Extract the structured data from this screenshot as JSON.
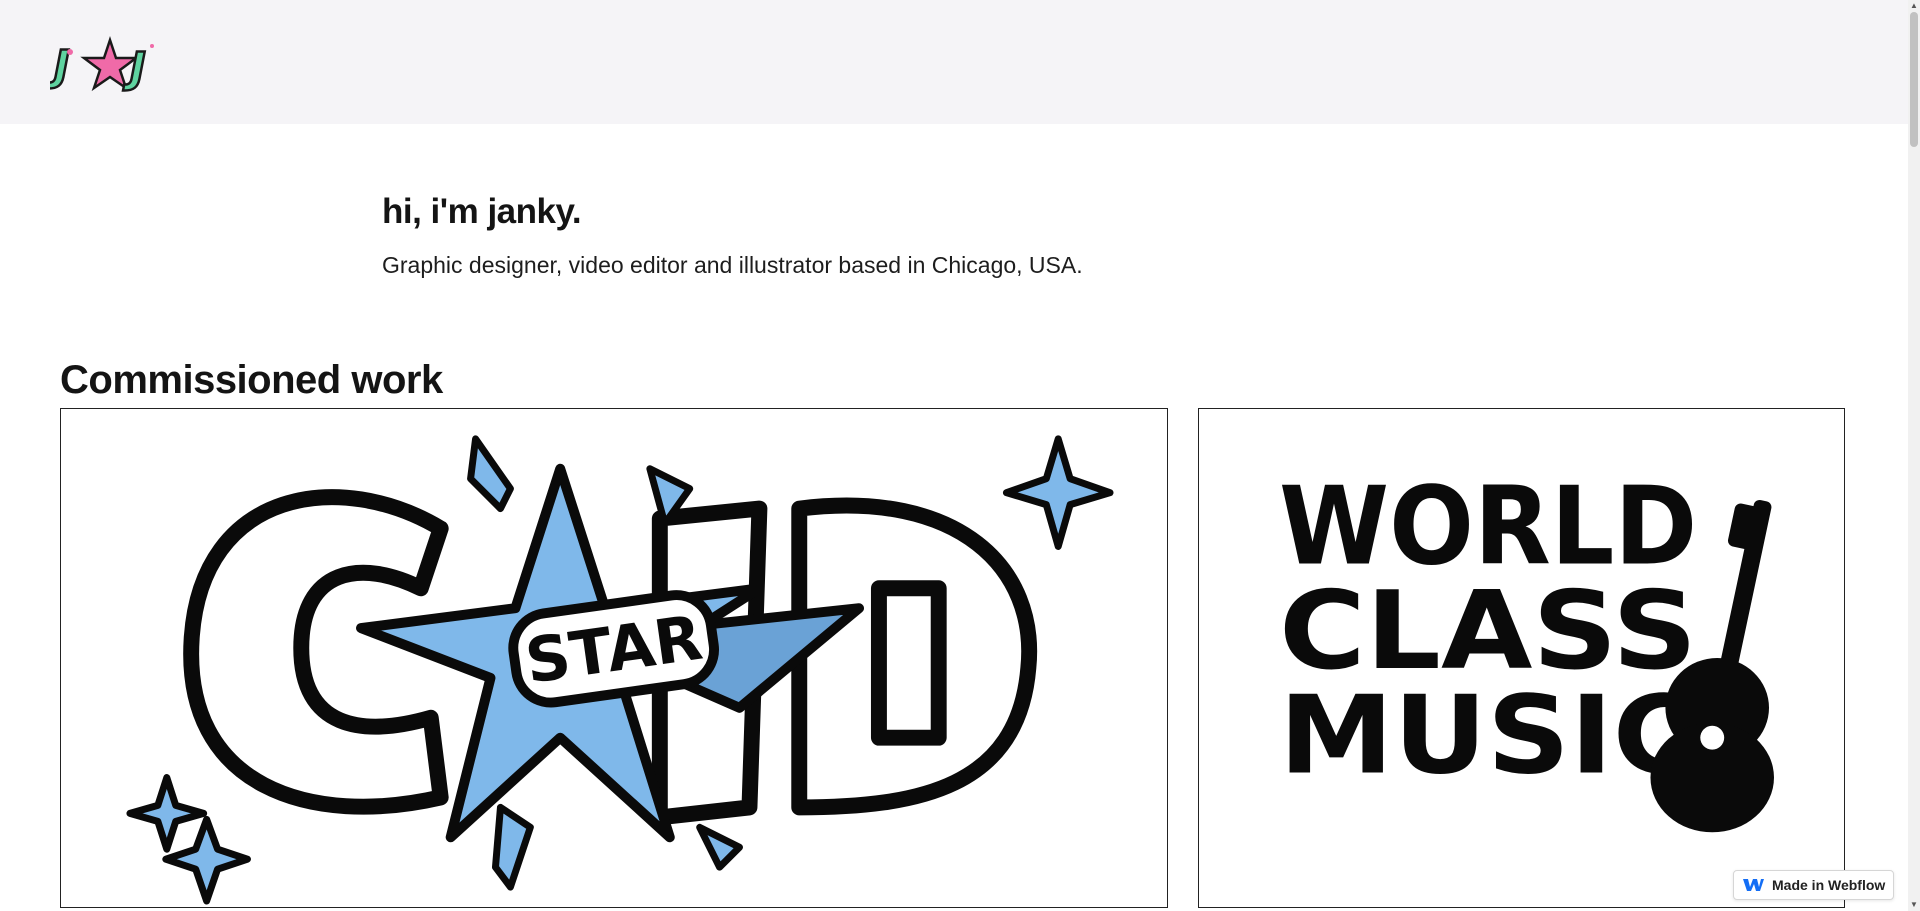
{
  "nav": {
    "logo_text": "JAJ",
    "logo_icon": "janky-logo"
  },
  "intro": {
    "heading": "hi, i'm janky.",
    "subtitle": "Graphic designer, video editor and illustrator based in Chicago, USA."
  },
  "section": {
    "title": "Commissioned work"
  },
  "works": [
    {
      "name": "Cold Star",
      "logo_word": "STAR",
      "accent": "#7fb8ea"
    },
    {
      "name": "World Class Music",
      "lines": [
        "WORLD",
        "CLASS",
        "MUSIC"
      ]
    }
  ],
  "badge": {
    "label": "Made in Webflow",
    "icon": "webflow-icon"
  },
  "colors": {
    "nav_bg": "#f5f4f7",
    "accent_blue": "#7fb8ea",
    "logo_green": "#5fd3a0",
    "logo_pink": "#f06aa8"
  }
}
